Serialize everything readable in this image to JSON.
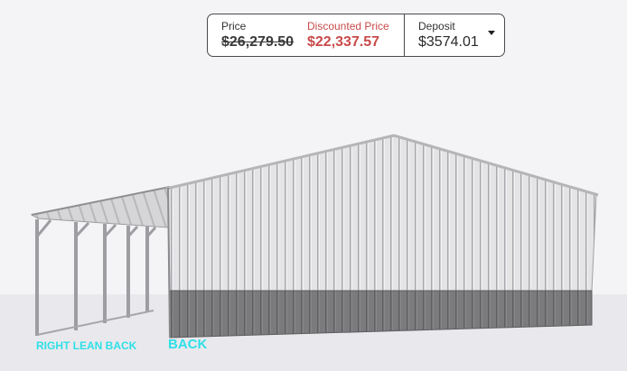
{
  "price_panel": {
    "price_label": "Price",
    "price_value": "$26,279.50",
    "discount_label": "Discounted Price",
    "discount_value": "$22,337.57",
    "deposit_label": "Deposit",
    "deposit_value": "$3574.01",
    "dropdown_icon": "caret-down-icon"
  },
  "view_labels": {
    "right_lean_back": "RIGHT LEAN BACK",
    "back": "BACK"
  },
  "colors": {
    "discount": "#c94a4a",
    "label_accent": "#2fe0e8",
    "wall_upper": "#e2e2e4",
    "wainscot": "#7a7a7a"
  }
}
